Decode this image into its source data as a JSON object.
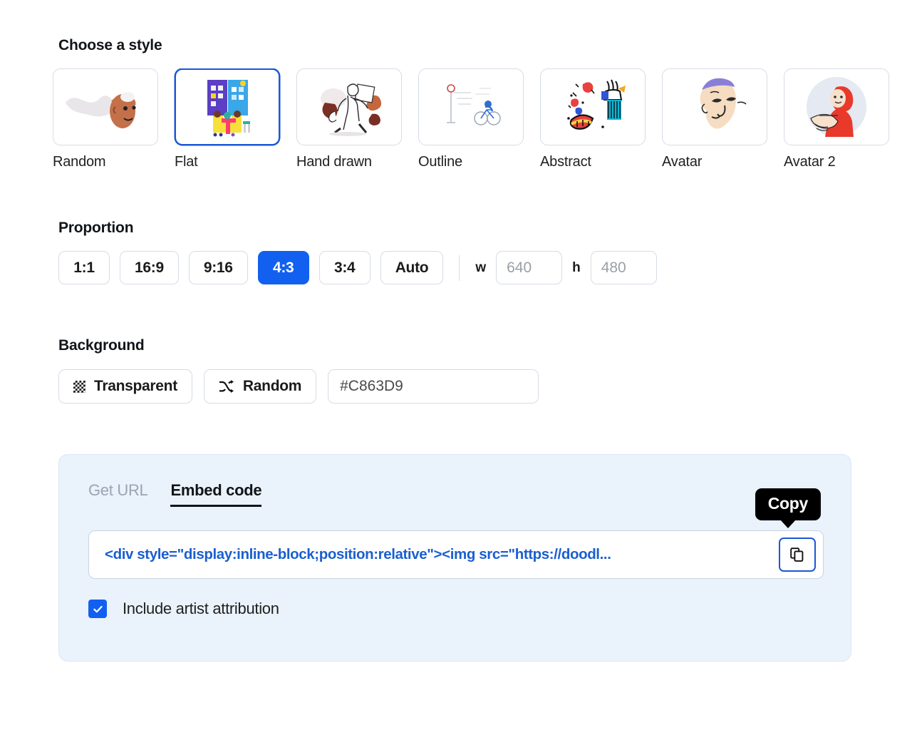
{
  "styles": {
    "heading": "Choose a style",
    "items": [
      {
        "label": "Random",
        "art": "random",
        "selected": false
      },
      {
        "label": "Flat",
        "art": "flat",
        "selected": true
      },
      {
        "label": "Hand drawn",
        "art": "hand-drawn",
        "selected": false
      },
      {
        "label": "Outline",
        "art": "outline",
        "selected": false
      },
      {
        "label": "Abstract",
        "art": "abstract",
        "selected": false
      },
      {
        "label": "Avatar",
        "art": "avatar",
        "selected": false
      },
      {
        "label": "Avatar 2",
        "art": "avatar-2",
        "selected": false
      }
    ]
  },
  "proportion": {
    "heading": "Proportion",
    "options": [
      {
        "label": "1:1",
        "active": false
      },
      {
        "label": "16:9",
        "active": false
      },
      {
        "label": "9:16",
        "active": false
      },
      {
        "label": "4:3",
        "active": true
      },
      {
        "label": "3:4",
        "active": false
      },
      {
        "label": "Auto",
        "active": false
      }
    ],
    "width_label": "w",
    "width_value": "640",
    "height_label": "h",
    "height_value": "480",
    "active_color": "#1260f0"
  },
  "background": {
    "heading": "Background",
    "transparent_label": "Transparent",
    "random_label": "Random",
    "hex_value": "#C863D9"
  },
  "share": {
    "tabs": [
      {
        "label": "Get URL",
        "active": false
      },
      {
        "label": "Embed code",
        "active": true
      }
    ],
    "embed_code": "<div style=\"display:inline-block;position:relative\"><img src=\"https://doodl...",
    "copy_tooltip": "Copy",
    "attribution_label": "Include artist attribution",
    "attribution_checked": true,
    "panel_color": "#eaf2fc",
    "code_color": "#1a5fd0"
  }
}
